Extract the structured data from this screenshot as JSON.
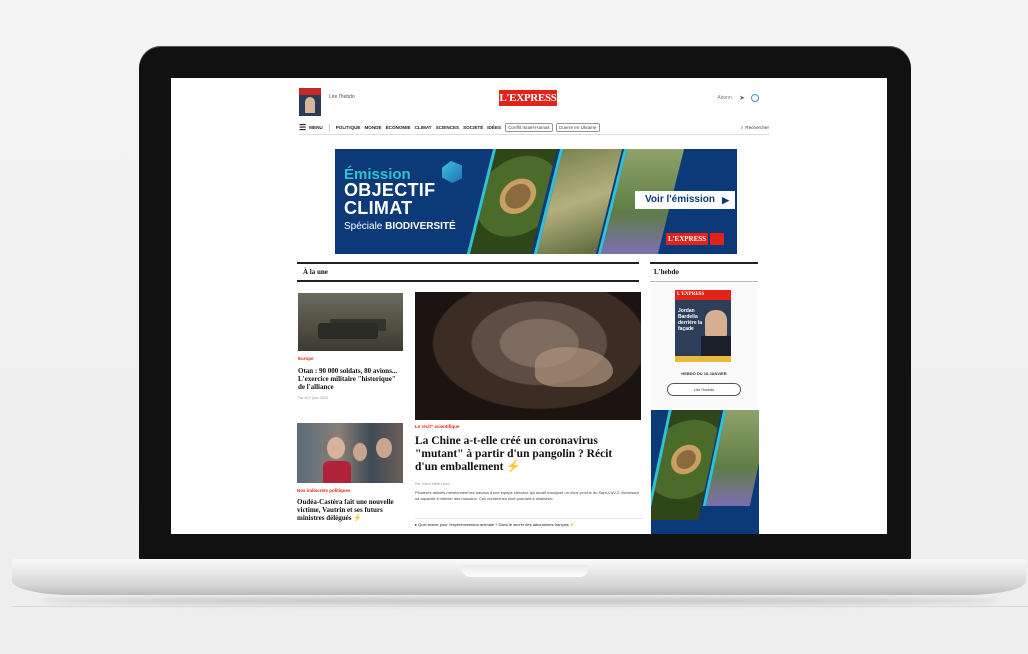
{
  "header": {
    "read_hebdo_small": "Lire l'hebdo",
    "logo": "L'EXPRESS",
    "top_right_label": "Abonn."
  },
  "nav": {
    "menu_label": "MENU",
    "links": [
      "POLITIQUE",
      "MONDE",
      "ÉCONOMIE",
      "CLIMAT",
      "SCIENCES",
      "SOCIÉTÉ",
      "IDÉES"
    ],
    "chips": [
      "Conflit Israël-Hamas",
      "Guerre en Ukraine"
    ],
    "search_label": "Rechercher"
  },
  "banner": {
    "emission": "Émission",
    "line1": "OBJECTIF",
    "line2": "CLIMAT",
    "sub_prefix": "Spéciale ",
    "sub_bold": "BIODIVERSITÉ",
    "cta": "Voir l'émission",
    "logo": "L'EXPRESS"
  },
  "main": {
    "section_title": "À la une",
    "article1": {
      "category": "Europe",
      "title": "Otan : 90 000 soldats, 80 avions... L'exercice militaire \"historique\" de l'alliance",
      "meta": "Par le P. janv 2024"
    },
    "featured": {
      "category": "Le récit\" scientifique",
      "title": "La Chine a-t-elle créé un coronavirus \"mutant\" à partir d'un pangolin ? Récit d'un emballement",
      "meta": "Par Victor Alibert pam",
      "excerpt": "Plusieurs articles mentionnent les travaux d'une équipe chinoise qui aurait manipulé un virus proche du Sars-CoV-2, favorisant sa capacité à infecter des humains. Ces recherches sont pourtant à relativiser.",
      "related": "Quel avenir pour l'expérimentation animale ? Dans le secret des laboratoires français"
    },
    "article2": {
      "category": "Nos indiscrets politiques",
      "title": "Oudéa-Castéra fait une nouvelle victime, Vautrin et ses futurs ministres délégués"
    }
  },
  "hebdo": {
    "title": "L'hebdo",
    "cover_logo": "L'EXPRESS",
    "cover_title": "Jordan Bardella derrière la façade",
    "date": "HEBDO DU 18 JANVIER",
    "button": "Lire l'hebdo"
  },
  "icons": [
    "menu-icon",
    "search-icon",
    "send-icon",
    "user-icon",
    "play-icon",
    "bolt-icon"
  ],
  "colors": {
    "brand_red": "#e2231a",
    "banner_blue": "#0c3978",
    "banner_cyan": "#2fc3d4",
    "bolt_yellow": "#f2c21a"
  }
}
